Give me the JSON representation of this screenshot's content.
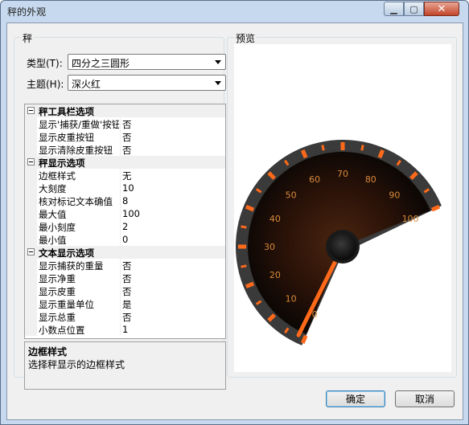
{
  "window": {
    "title": "秤的外观",
    "minimize_icon": "minimize-icon",
    "maximize_icon": "maximize-icon",
    "close_icon": "close-icon"
  },
  "left_group": {
    "label": "秤",
    "type_label": "类型(T):",
    "type_value": "四分之三圆形",
    "theme_label": "主题(H):",
    "theme_value": "深火红"
  },
  "property_grid": {
    "sections": [
      {
        "name": "秤工具栏选项",
        "rows": [
          {
            "name": "显示'捕获/重做'按钮",
            "value": "否"
          },
          {
            "name": "显示皮重按钮",
            "value": "否"
          },
          {
            "name": "显示清除皮重按钮",
            "value": "否"
          }
        ]
      },
      {
        "name": "秤显示选项",
        "rows": [
          {
            "name": "边框样式",
            "value": "无"
          },
          {
            "name": "大刻度",
            "value": "10"
          },
          {
            "name": "核对标记文本确值",
            "value": "8"
          },
          {
            "name": "最大值",
            "value": "100"
          },
          {
            "name": "最小刻度",
            "value": "2"
          },
          {
            "name": "最小值",
            "value": "0"
          }
        ]
      },
      {
        "name": "文本显示选项",
        "rows": [
          {
            "name": "显示捕获的重量",
            "value": "否"
          },
          {
            "name": "显示净重",
            "value": "否"
          },
          {
            "name": "显示皮重",
            "value": "否"
          },
          {
            "name": "显示重量单位",
            "value": "是"
          },
          {
            "name": "显示总重",
            "value": "否"
          },
          {
            "name": "小数点位置",
            "value": "1"
          }
        ]
      }
    ]
  },
  "description": {
    "title": "边框样式",
    "text": "选择秤显示的边框样式"
  },
  "preview": {
    "label": "预览",
    "gauge": {
      "min": 0,
      "max": 100,
      "major_step": 10,
      "value": 0,
      "labels": [
        "0",
        "10",
        "20",
        "30",
        "40",
        "50",
        "60",
        "70",
        "80",
        "90",
        "100"
      ],
      "accent_color": "#ff6a1a",
      "bezel_color": "#3a3a3a",
      "face_color": "#2b1408"
    }
  },
  "buttons": {
    "ok": "确定",
    "cancel": "取消"
  }
}
